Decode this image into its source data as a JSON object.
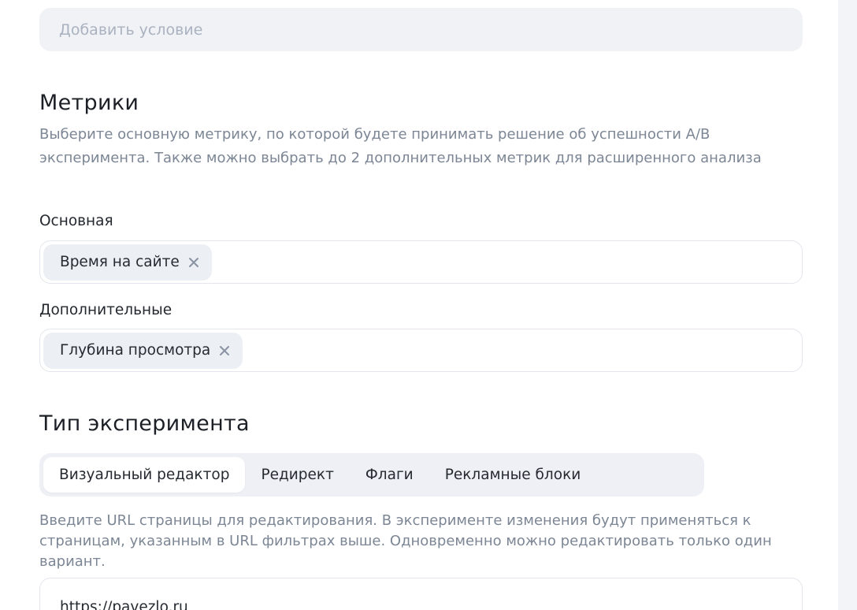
{
  "conditions": {
    "add_placeholder": "Добавить условие"
  },
  "metrics": {
    "title": "Метрики",
    "description": "Выберите основную метрику, по которой будете принимать решение об успешности A/B эксперимента. Также можно выбрать до 2 дополнительных метрик для расширенного анализа",
    "primary": {
      "label": "Основная",
      "selected": [
        "Время на сайте"
      ]
    },
    "additional": {
      "label": "Дополнительные",
      "selected": [
        "Глубина просмотра"
      ]
    }
  },
  "experiment_type": {
    "title": "Тип эксперимента",
    "tabs": [
      {
        "label": "Визуальный редактор",
        "active": true
      },
      {
        "label": "Редирект",
        "active": false
      },
      {
        "label": "Флаги",
        "active": false
      },
      {
        "label": "Рекламные блоки",
        "active": false
      }
    ],
    "description": "Введите URL страницы для редактирования. В эксперименте изменения будут применяться к страницам, указанным в URL фильтрах выше. Одновременно можно редактировать только один вариант.",
    "url_value": "https://pavezlo.ru"
  },
  "colors": {
    "page_background": "#ffffff",
    "muted_text": "#7c8694",
    "chip_background": "#eceff4",
    "input_border": "#e3e6ec"
  },
  "icons": {
    "chip_remove": "close-icon"
  }
}
